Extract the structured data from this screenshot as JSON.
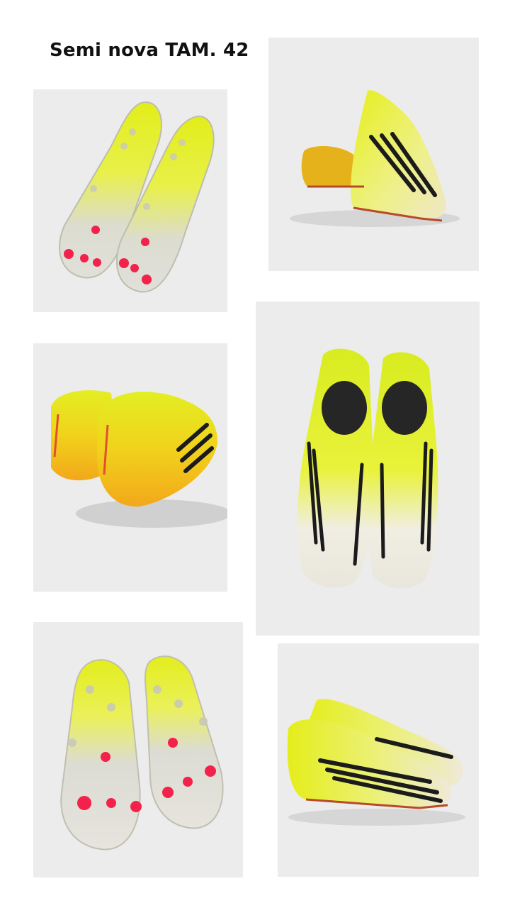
{
  "title": "Semi nova TAM. 42",
  "colors": {
    "background": "#ffffff",
    "photo_bg": "#ececec",
    "boot_yellow": "#e4ee1f",
    "boot_white": "#e9e6dd",
    "boot_orange": "#f2b21c",
    "stud_red": "#f2224a",
    "stripe_black": "#1b1b1b"
  },
  "photos": [
    {
      "view": "soles-top"
    },
    {
      "view": "side-pair"
    },
    {
      "view": "heels"
    },
    {
      "view": "top-down"
    },
    {
      "view": "soles-bottom"
    },
    {
      "view": "side-pair-low"
    }
  ]
}
